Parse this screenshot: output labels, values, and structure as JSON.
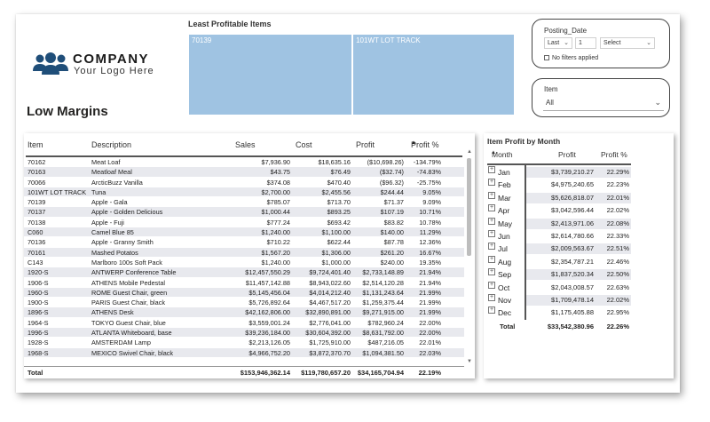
{
  "logo": {
    "company": "COMPANY",
    "tagline": "Your Logo Here"
  },
  "page_title": "Low Margins",
  "treemap": {
    "title": "Least Profitable Items",
    "cells": [
      {
        "label": "70139",
        "color": "#9fc3e2"
      },
      {
        "label": "101WT LOT TRACK",
        "color": "#9fc3e2"
      }
    ]
  },
  "posting_date_slicer": {
    "title": "Posting_Date",
    "relative": "Last",
    "count": "1",
    "unit": "Select",
    "note": "No filters applied"
  },
  "item_slicer": {
    "title": "Item",
    "value": "All"
  },
  "items_table": {
    "columns": {
      "item": "Item",
      "description": "Description",
      "sales": "Sales",
      "cost": "Cost",
      "profit": "Profit",
      "pct": "Profit %"
    },
    "rows": [
      {
        "item": "70162",
        "description": "Meat Loaf",
        "sales": "$7,936.90",
        "cost": "$18,635.16",
        "profit": "($10,698.26)",
        "pct": "-134.79%"
      },
      {
        "item": "70163",
        "description": "Meatloaf Meal",
        "sales": "$43.75",
        "cost": "$76.49",
        "profit": "($32.74)",
        "pct": "-74.83%"
      },
      {
        "item": "70066",
        "description": "ArcticBuzz Vanilla",
        "sales": "$374.08",
        "cost": "$470.40",
        "profit": "($96.32)",
        "pct": "-25.75%"
      },
      {
        "item": "101WT LOT TRACK",
        "description": "Tuna",
        "sales": "$2,700.00",
        "cost": "$2,455.56",
        "profit": "$244.44",
        "pct": "9.05%"
      },
      {
        "item": "70139",
        "description": "Apple - Gala",
        "sales": "$785.07",
        "cost": "$713.70",
        "profit": "$71.37",
        "pct": "9.09%"
      },
      {
        "item": "70137",
        "description": "Apple - Golden Delicious",
        "sales": "$1,000.44",
        "cost": "$893.25",
        "profit": "$107.19",
        "pct": "10.71%"
      },
      {
        "item": "70138",
        "description": "Apple - Fuji",
        "sales": "$777.24",
        "cost": "$693.42",
        "profit": "$83.82",
        "pct": "10.78%"
      },
      {
        "item": "C060",
        "description": "Camel Blue 85",
        "sales": "$1,240.00",
        "cost": "$1,100.00",
        "profit": "$140.00",
        "pct": "11.29%"
      },
      {
        "item": "70136",
        "description": "Apple - Granny Smith",
        "sales": "$710.22",
        "cost": "$622.44",
        "profit": "$87.78",
        "pct": "12.36%"
      },
      {
        "item": "70161",
        "description": "Mashed Potatos",
        "sales": "$1,567.20",
        "cost": "$1,306.00",
        "profit": "$261.20",
        "pct": "16.67%"
      },
      {
        "item": "C143",
        "description": "Marlboro 100s Soft Pack",
        "sales": "$1,240.00",
        "cost": "$1,000.00",
        "profit": "$240.00",
        "pct": "19.35%"
      },
      {
        "item": "1920-S",
        "description": "ANTWERP Conference Table",
        "sales": "$12,457,550.29",
        "cost": "$9,724,401.40",
        "profit": "$2,733,148.89",
        "pct": "21.94%"
      },
      {
        "item": "1906-S",
        "description": "ATHENS Mobile Pedestal",
        "sales": "$11,457,142.88",
        "cost": "$8,943,022.60",
        "profit": "$2,514,120.28",
        "pct": "21.94%"
      },
      {
        "item": "1960-S",
        "description": "ROME Guest Chair, green",
        "sales": "$5,145,456.04",
        "cost": "$4,014,212.40",
        "profit": "$1,131,243.64",
        "pct": "21.99%"
      },
      {
        "item": "1900-S",
        "description": "PARIS Guest Chair, black",
        "sales": "$5,726,892.64",
        "cost": "$4,467,517.20",
        "profit": "$1,259,375.44",
        "pct": "21.99%"
      },
      {
        "item": "1896-S",
        "description": "ATHENS Desk",
        "sales": "$42,162,806.00",
        "cost": "$32,890,891.00",
        "profit": "$9,271,915.00",
        "pct": "21.99%"
      },
      {
        "item": "1964-S",
        "description": "TOKYO Guest Chair, blue",
        "sales": "$3,559,001.24",
        "cost": "$2,776,041.00",
        "profit": "$782,960.24",
        "pct": "22.00%"
      },
      {
        "item": "1996-S",
        "description": "ATLANTA Whiteboard, base",
        "sales": "$39,236,184.00",
        "cost": "$30,604,392.00",
        "profit": "$8,631,792.00",
        "pct": "22.00%"
      },
      {
        "item": "1928-S",
        "description": "AMSTERDAM Lamp",
        "sales": "$2,213,126.05",
        "cost": "$1,725,910.00",
        "profit": "$487,216.05",
        "pct": "22.01%"
      },
      {
        "item": "1968-S",
        "description": "MEXICO Swivel Chair, black",
        "sales": "$4,966,752.20",
        "cost": "$3,872,370.70",
        "profit": "$1,094,381.50",
        "pct": "22.03%"
      }
    ],
    "total": {
      "label": "Total",
      "sales": "$153,946,362.14",
      "cost": "$119,780,657.20",
      "profit": "$34,165,704.94",
      "pct": "22.19%"
    }
  },
  "month_matrix": {
    "title": "Item Profit by Month",
    "columns": {
      "month": "Month",
      "profit": "Profit",
      "pct": "Profit %"
    },
    "rows": [
      {
        "month": "Jan",
        "profit": "$3,739,210.27",
        "pct": "22.29%"
      },
      {
        "month": "Feb",
        "profit": "$4,975,240.65",
        "pct": "22.23%"
      },
      {
        "month": "Mar",
        "profit": "$5,626,818.07",
        "pct": "22.01%"
      },
      {
        "month": "Apr",
        "profit": "$3,042,596.44",
        "pct": "22.02%"
      },
      {
        "month": "May",
        "profit": "$2,413,971.06",
        "pct": "22.08%"
      },
      {
        "month": "Jun",
        "profit": "$2,614,780.66",
        "pct": "22.33%"
      },
      {
        "month": "Jul",
        "profit": "$2,009,563.67",
        "pct": "22.51%"
      },
      {
        "month": "Aug",
        "profit": "$2,354,787.21",
        "pct": "22.46%"
      },
      {
        "month": "Sep",
        "profit": "$1,837,520.34",
        "pct": "22.50%"
      },
      {
        "month": "Oct",
        "profit": "$2,043,008.57",
        "pct": "22.63%"
      },
      {
        "month": "Nov",
        "profit": "$1,709,478.14",
        "pct": "22.02%"
      },
      {
        "month": "Dec",
        "profit": "$1,175,405.88",
        "pct": "22.95%"
      }
    ],
    "total": {
      "label": "Total",
      "profit": "$33,542,380.96",
      "pct": "22.26%"
    }
  },
  "colors": {
    "treemap_fill": "#9fc3e2",
    "row_alt": "#e8e9ee",
    "logo_blue": "#1f4e79"
  }
}
